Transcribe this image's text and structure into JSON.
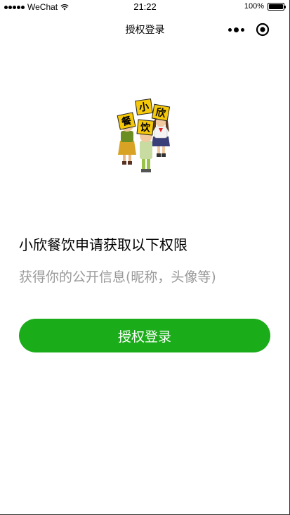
{
  "status_bar": {
    "carrier": "WeChat",
    "time": "21:22",
    "battery": "100%",
    "battery_level": 1.0
  },
  "nav": {
    "title": "授权登录",
    "icons": [
      "more-icon",
      "target-icon"
    ]
  },
  "illustration": {
    "sign_chars": [
      "小",
      "欣",
      "餐",
      "饮"
    ]
  },
  "content": {
    "permission_title": "小欣餐饮申请获取以下权限",
    "permission_desc": "获得你的公开信息(昵称，头像等)"
  },
  "auth_button": {
    "label": "授权登录",
    "color": "#1aad19"
  }
}
